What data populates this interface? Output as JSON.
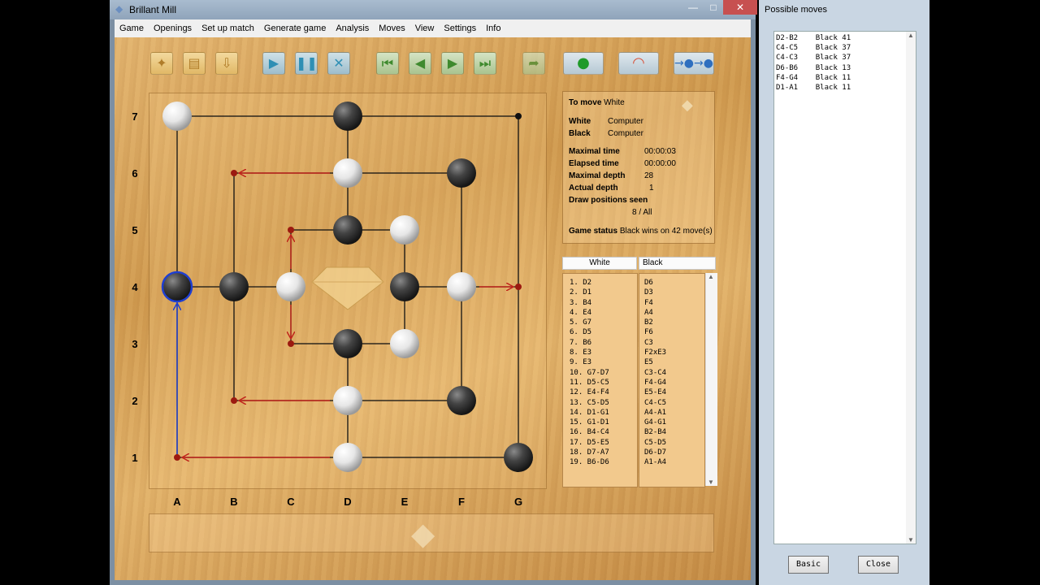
{
  "window": {
    "title": "Brillant Mill"
  },
  "window_buttons": {
    "minimize": "—",
    "maximize": "□",
    "close": "✕"
  },
  "menu": [
    "Game",
    "Openings",
    "Set up match",
    "Generate game",
    "Analysis",
    "Moves",
    "View",
    "Settings",
    "Info"
  ],
  "board": {
    "files": [
      "A",
      "B",
      "C",
      "D",
      "E",
      "F",
      "G"
    ],
    "ranks": [
      "7",
      "6",
      "5",
      "4",
      "3",
      "2",
      "1"
    ],
    "white_stones": [
      "A7",
      "D6",
      "E5",
      "C4",
      "F4",
      "E3",
      "D2",
      "D1"
    ],
    "black_stones": [
      "D7",
      "F6",
      "D5",
      "B4",
      "E4",
      "D3",
      "F2",
      "G1"
    ],
    "selected": "A4",
    "arrows_red": [
      [
        "B6",
        "D6"
      ],
      [
        "C5",
        "C4"
      ],
      [
        "C3",
        "C4"
      ],
      [
        "G4",
        "F4"
      ],
      [
        "B2",
        "D2"
      ],
      [
        "A1",
        "D1"
      ]
    ],
    "arrow_blue": [
      "A1",
      "A4"
    ]
  },
  "info": {
    "to_move_label": "To move",
    "to_move_value": "White",
    "white_label": "White",
    "white_value": "Computer",
    "black_label": "Black",
    "black_value": "Computer",
    "max_time_label": "Maximal time",
    "max_time_value": "00:00:03",
    "elapsed_label": "Elapsed time",
    "elapsed_value": "00:00:00",
    "max_depth_label": "Maximal depth",
    "max_depth_value": "28",
    "actual_depth_label": "Actual depth",
    "actual_depth_value": "1",
    "draw_label": "Draw positions seen",
    "draw_value": "8 / All",
    "status_label": "Game status",
    "status_value": "Black wins on 42 move(s)"
  },
  "moves_table": {
    "white_header": "White",
    "black_header": "Black",
    "white": [
      "1.  D2",
      "2.  D1",
      "3.  B4",
      "4.  E4",
      "5.  G7",
      "6.  D5",
      "7.  B6",
      "8.  E3",
      "9.  E3",
      "10.  G7-D7",
      "11.  D5-C5",
      "12.  E4-F4",
      "13.  C5-D5",
      "14.  D1-G1",
      "15.  G1-D1",
      "16.  B4-C4",
      "17.  D5-E5",
      "18.  D7-A7",
      "19.  B6-D6"
    ],
    "black": [
      "D6",
      "D3",
      "F4",
      "A4",
      "B2",
      "F6",
      "C3",
      "F2xE3",
      "E5",
      "C3-C4",
      "F4-G4",
      "E5-E4",
      "C4-C5",
      "A4-A1",
      "G4-G1",
      "B2-B4",
      "C5-D5",
      "D6-D7",
      "A1-A4"
    ]
  },
  "possible_moves": {
    "title": "Possible moves",
    "lines": [
      "D2-B2    Black 41",
      "C4-C5    Black 37",
      "C4-C3    Black 37",
      "D6-B6    Black 13",
      "F4-G4    Black 11",
      "D1-A1    Black 11"
    ],
    "basic_label": "Basic",
    "close_label": "Close"
  }
}
